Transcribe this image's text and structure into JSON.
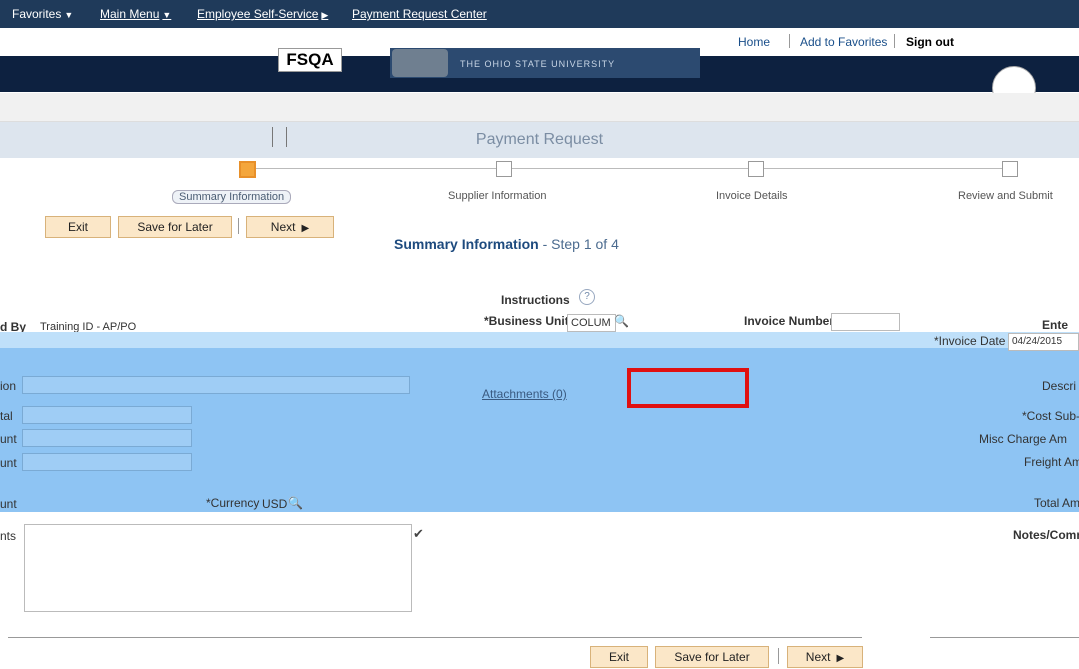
{
  "favbar": {
    "favorites": "Favorites",
    "main_menu": "Main Menu",
    "employee_self_service": "Employee Self-Service",
    "payment_request_center": "Payment Request Center"
  },
  "header": {
    "home": "Home",
    "add_to_favorites": "Add to Favorites",
    "sign_out": "Sign out",
    "environment": "FSQA",
    "banner_text": "THE OHIO STATE UNIVERSITY"
  },
  "page": {
    "title": "Payment Request"
  },
  "train": {
    "steps": [
      {
        "label": "Summary Information",
        "active": true
      },
      {
        "label": "Supplier Information",
        "active": false
      },
      {
        "label": "Invoice Details",
        "active": false
      },
      {
        "label": "Review and Submit",
        "active": false
      }
    ]
  },
  "buttons": {
    "exit": "Exit",
    "save_for_later": "Save for Later",
    "next": "Next"
  },
  "step_heading": {
    "title": "Summary Information",
    "sub": " - Step 1 of 4"
  },
  "form": {
    "instructions": "Instructions",
    "entered_by_label": "d By",
    "entered_by_value": "Training ID - AP/PO",
    "business_unit_label": "*Business Unit",
    "business_unit_value": "COLUM",
    "invoice_number_label": "Invoice Number",
    "enter_label": "Ente",
    "invoice_date_label": "*Invoice Date",
    "invoice_date_value": "04/24/2015",
    "description_left_label": "ion",
    "attachments": "Attachments (0)",
    "description_right_label": "Descri",
    "total_label": "tal",
    "cost_label": "*Cost Sub-",
    "amount_label_1": "unt",
    "misc_charge_label": "Misc Charge Am",
    "amount_label_2": "unt",
    "freight_label": "Freight Am",
    "amount_label_3": "unt",
    "currency_label": "*Currency",
    "currency_value": "USD",
    "total_amount_label": "Total Am",
    "comments_label": "nts",
    "notes_label": "Notes/Comm"
  },
  "colors": {
    "favbar": "#1f3a5a",
    "band": "#8ec4f3",
    "button": "#fbe7c8",
    "highlight": "#e01010",
    "active_step": "#f4a63c"
  }
}
